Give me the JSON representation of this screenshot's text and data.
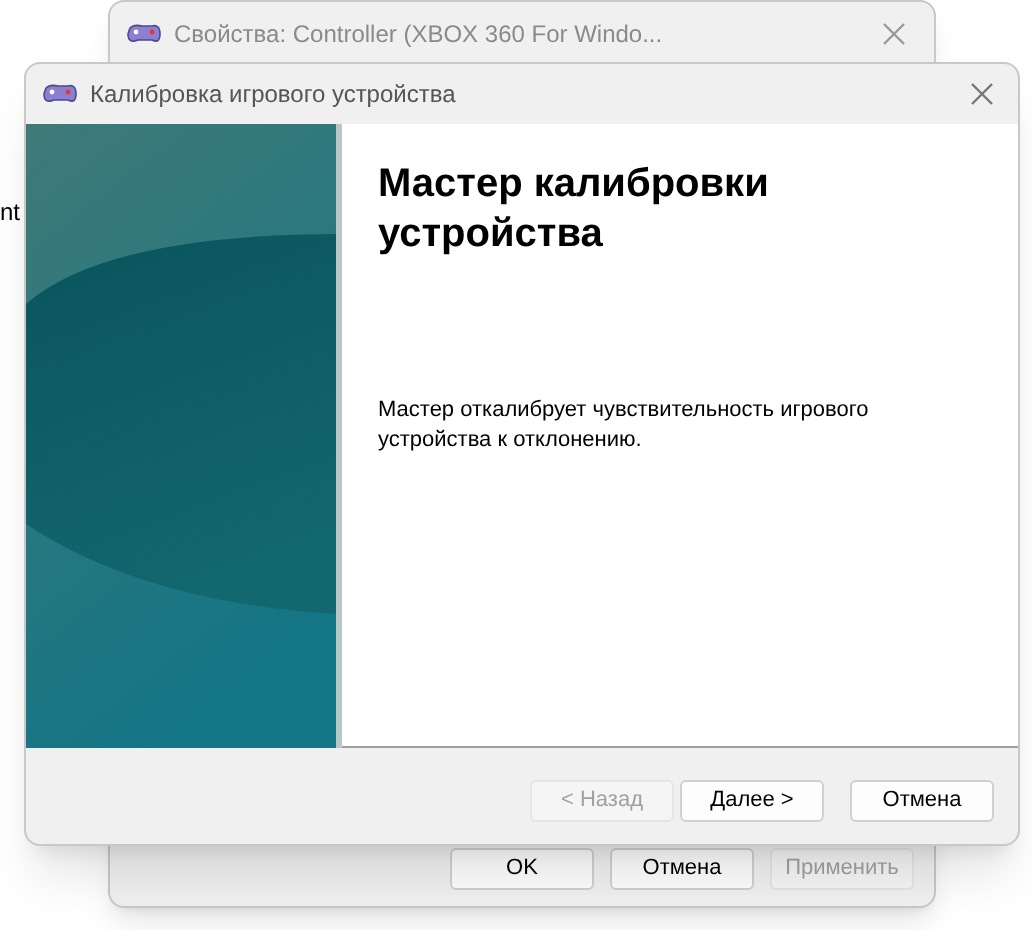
{
  "back_window": {
    "title": "Свойства: Controller (XBOX 360 For Windo...",
    "fragments_left": [
      "nt"
    ],
    "buttons": [
      {
        "label": "OK",
        "disabled": false
      },
      {
        "label": "Отмена",
        "disabled": false
      },
      {
        "label": "Применить",
        "disabled": true
      }
    ]
  },
  "dialog": {
    "title": "Калибровка игрового устройства",
    "heading": "Мастер калибровки устройства",
    "description": "Мастер откалибрует чувствительность игрового устройства к отклонению.",
    "buttons": [
      {
        "label": "< Назад",
        "disabled": true
      },
      {
        "label": "Далее >",
        "disabled": false
      },
      {
        "label": "Отмена",
        "disabled": false
      }
    ]
  }
}
